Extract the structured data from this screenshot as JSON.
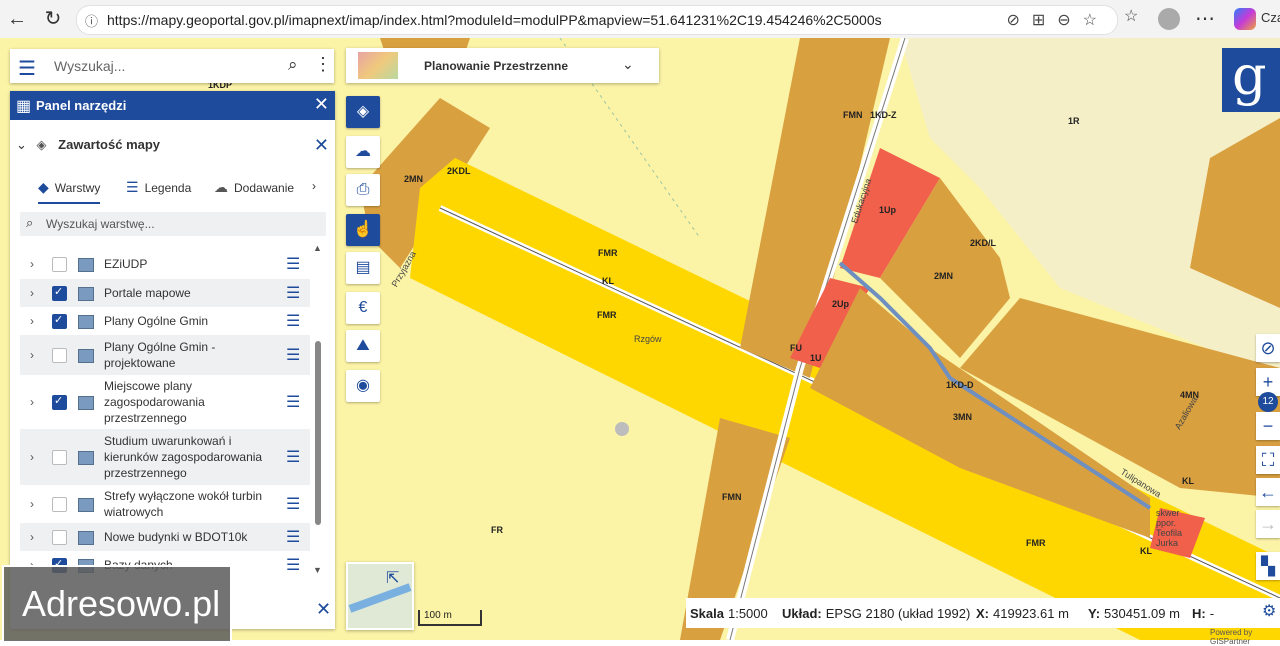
{
  "browser": {
    "url": "https://mapy.geoportal.gov.pl/imapnext/imap/index.html?moduleId=modulPP&mapview=51.641231%2C19.454246%2C5000s",
    "profile_label": "Cza"
  },
  "search": {
    "placeholder": "Wyszukaj..."
  },
  "panel": {
    "title": "Panel narzędzi",
    "section_title": "Zawartość mapy",
    "tabs": [
      {
        "label": "Warstwy"
      },
      {
        "label": "Legenda"
      },
      {
        "label": "Dodawanie"
      }
    ],
    "layer_search_placeholder": "Wyszukaj warstwę...",
    "layers": [
      {
        "label": "EZiUDP",
        "checked": false
      },
      {
        "label": "Portale mapowe",
        "checked": true
      },
      {
        "label": "Plany Ogólne Gmin",
        "checked": true
      },
      {
        "label": "Plany Ogólne Gmin - projektowane",
        "checked": false
      },
      {
        "label": "Miejscowe plany zagospodarowania przestrzennego",
        "checked": true
      },
      {
        "label": "Studium uwarunkowań i kierunków zagospodarowania przestrzennego",
        "checked": false
      },
      {
        "label": "Strefy wyłączone wokół turbin wiatrowych",
        "checked": false
      },
      {
        "label": "Nowe budynki w BDOT10k",
        "checked": false
      },
      {
        "label": "Bazy danych",
        "checked": true
      }
    ]
  },
  "module": {
    "label": "Planowanie Przestrzenne"
  },
  "watermark": {
    "text": "Adresowo.pl"
  },
  "zoom": {
    "level": "12"
  },
  "scalebar": {
    "label": "100 m"
  },
  "status": {
    "scale_label": "Skala",
    "scale_value": "1:5000",
    "crs_label": "Układ:",
    "crs_value": "EPSG 2180 (układ 1992)",
    "x_label": "X:",
    "x_value": "419923.61 m",
    "y_label": "Y:",
    "y_value": "530451.09 m",
    "h_label": "H:",
    "h_value": "-",
    "powered": "Powered by GISPartner"
  },
  "map_labels": {
    "l1": "1KDP",
    "l2": "2MN",
    "l3": "2KDL",
    "l4": "FMN",
    "l5": "1KD-Z",
    "l6": "1R",
    "l7": "Edukacyjna",
    "l8": "1Up",
    "l9": "2KD/L",
    "l10": "2MN",
    "l11": "FMR",
    "l12": "KL",
    "l13": "FMR",
    "l14": "Rzgów",
    "l15": "Przyjazna",
    "l16": "2Up",
    "l17": "FU",
    "l18": "1U",
    "l19": "1KD-D",
    "l20": "3MN",
    "l21": "4MN",
    "l22": "Azaliowa",
    "l23": "Tulipanowa",
    "l24": "KL",
    "l25": "FMN",
    "l26": "FR",
    "l27": "FMR",
    "l28": "KL",
    "l29": "skwer ppor. Teofila Jurka"
  },
  "colors": {
    "brand": "#1e4b9b",
    "fmr": "#ffd700",
    "mn": "#d9a040",
    "up": "#f0604a",
    "agri": "#fbf3a6"
  }
}
